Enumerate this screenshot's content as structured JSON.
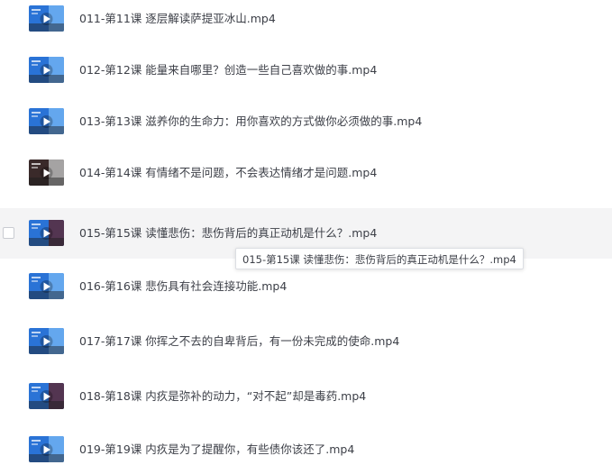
{
  "files": [
    {
      "name": "011-第11课 逐层解读萨提亚冰山.mp4",
      "thumb": "blue"
    },
    {
      "name": "012-第12课 能量来自哪里？创造一些自己喜欢做的事.mp4",
      "thumb": "blue"
    },
    {
      "name": "013-第13课 滋养你的生命力：用你喜欢的方式做你必须做的事.mp4",
      "thumb": "blue"
    },
    {
      "name": "014-第14课 有情绪不是问题，不会表达情绪才是问题.mp4",
      "thumb": "dark"
    },
    {
      "name": "015-第15课 读懂悲伤：悲伤背后的真正动机是什么？.mp4",
      "thumb": "mixed"
    },
    {
      "name": "016-第16课 悲伤具有社会连接功能.mp4",
      "thumb": "blue"
    },
    {
      "name": "017-第17课 你挥之不去的自卑背后，有一份未完成的使命.mp4",
      "thumb": "blue"
    },
    {
      "name": "018-第18课 内疚是弥补的动力，“对不起”却是毒药.mp4",
      "thumb": "mixed"
    },
    {
      "name": "019-第19课 内疚是为了提醒你，有些债你该还了.mp4",
      "thumb": "blue"
    }
  ],
  "hovered_index": 4,
  "tooltip": {
    "text": "015-第15课 读懂悲伤：悲伤背后的真正动机是什么？.mp4"
  },
  "colors": {
    "text": "#3c3f47",
    "hover_bg": "#f4f4f5",
    "thumb_blue": "#2a73d6",
    "thumb_dark": "#3a2a2a"
  }
}
